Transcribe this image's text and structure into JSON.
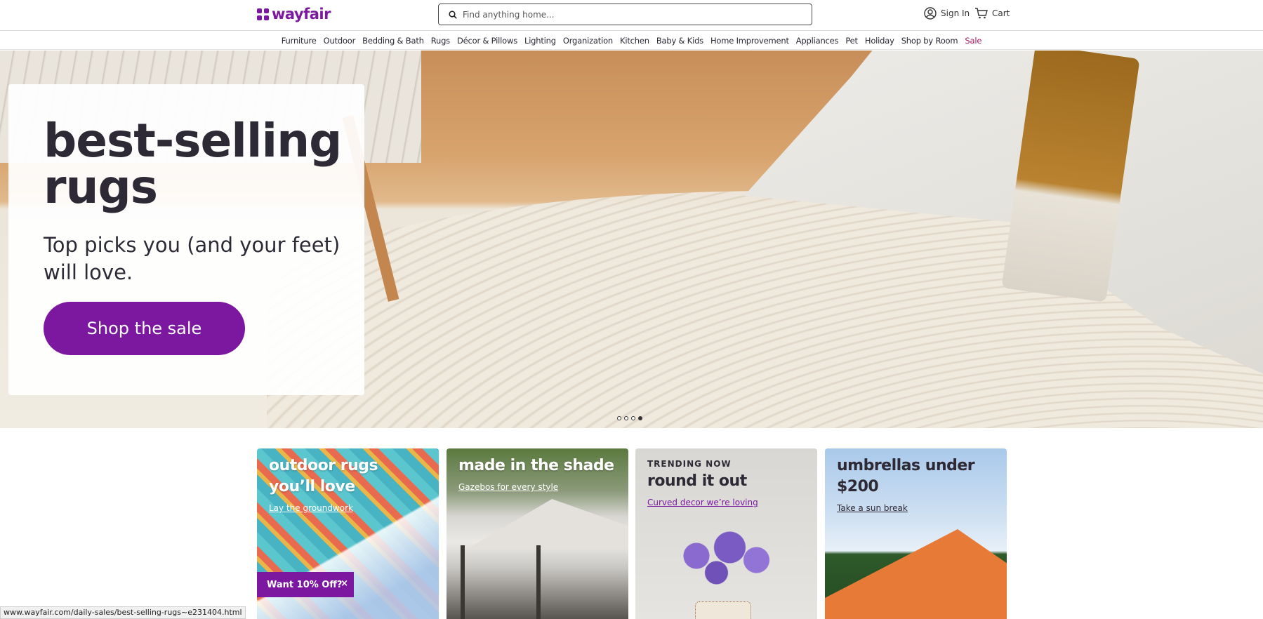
{
  "header": {
    "logo_text": "wayfair",
    "search_placeholder": "Find anything home...",
    "sign_in_label": "Sign In",
    "cart_label": "Cart",
    "brand_color": "#7b189f"
  },
  "nav": {
    "items": [
      "Furniture",
      "Outdoor",
      "Bedding & Bath",
      "Rugs",
      "Décor & Pillows",
      "Lighting",
      "Organization",
      "Kitchen",
      "Baby & Kids",
      "Home Improvement",
      "Appliances",
      "Pet",
      "Holiday",
      "Shop by Room",
      "Sale"
    ]
  },
  "hero": {
    "title": "best-selling rugs",
    "subtitle": "Top picks you (and your feet) will love.",
    "cta": "Shop the sale",
    "slides_total": 4,
    "active_slide": 4
  },
  "tiles": [
    {
      "title": "outdoor rugs you’ll love",
      "link": "Lay the groundwork"
    },
    {
      "title": "made in the shade",
      "link": "Gazebos for every style"
    },
    {
      "eyebrow": "TRENDING NOW",
      "title": "round it out",
      "link": "Curved decor we’re loving"
    },
    {
      "title": "umbrellas under $200",
      "link": "Take a sun break"
    }
  ],
  "promo": {
    "label": "Want 10% Off?",
    "close": "×"
  },
  "status_bar": {
    "url": "www.wayfair.com/daily-sales/best-selling-rugs~e231404.html"
  }
}
